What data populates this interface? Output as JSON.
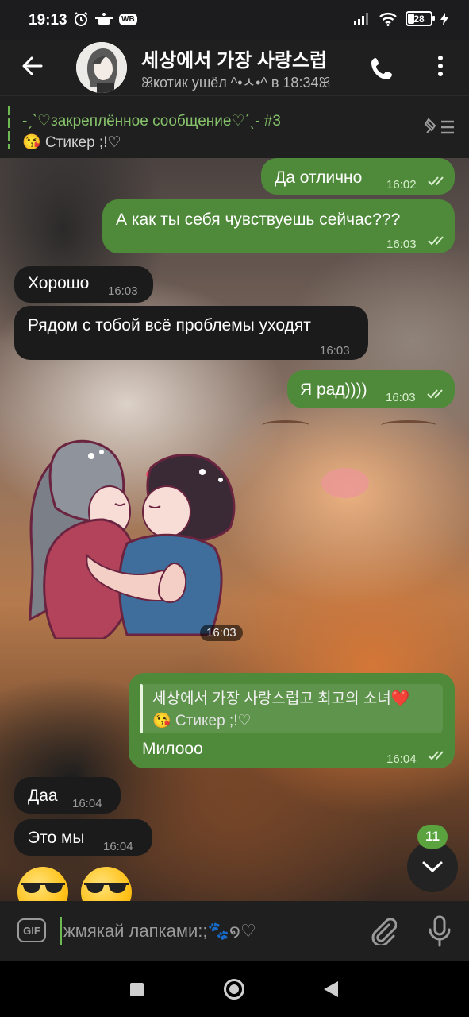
{
  "status_bar": {
    "time": "19:13",
    "wb_badge": "WB",
    "battery": "28"
  },
  "header": {
    "title": "세상에서 가장 사랑스럽",
    "status": "ꕤкотик ушёл ^•ㅅ•^ в 18:34ꕤ"
  },
  "pinned": {
    "title": "-ˏˋ♡закреплённое сообщение♡ˊˎ- #3",
    "text": "😘 Стикер ;!♡"
  },
  "messages": [
    {
      "dir": "out",
      "text": "Да отлично",
      "time": "16:02"
    },
    {
      "dir": "out",
      "text": "А как ты себя чувствуешь сейчас???",
      "time": "16:03"
    },
    {
      "dir": "in",
      "text": "Хорошо",
      "time": "16:03"
    },
    {
      "dir": "in",
      "text": "Рядом с тобой всё проблемы уходят",
      "time": "16:03"
    },
    {
      "dir": "out",
      "text": "Я рад))))",
      "time": "16:03"
    },
    {
      "dir": "in",
      "type": "sticker",
      "time": "16:03"
    },
    {
      "dir": "out",
      "reply_title": "세상에서 가장 사랑스럽고 최고의 소녀❤️",
      "reply_text": "😘 Стикер ;!♡",
      "text": "Милооо",
      "time": "16:04"
    },
    {
      "dir": "in",
      "text": "Даа",
      "time": "16:04"
    },
    {
      "dir": "in",
      "text": "Это мы",
      "time": "16:04"
    }
  ],
  "unread_count": "11",
  "input": {
    "placeholder": "жмякай лапками:;🐾໑♡",
    "gif_label": "GIF"
  },
  "colors": {
    "outgoing_bubble": "#4f8a3a",
    "incoming_bubble": "#1b1b1b",
    "accent": "#6dba52"
  }
}
